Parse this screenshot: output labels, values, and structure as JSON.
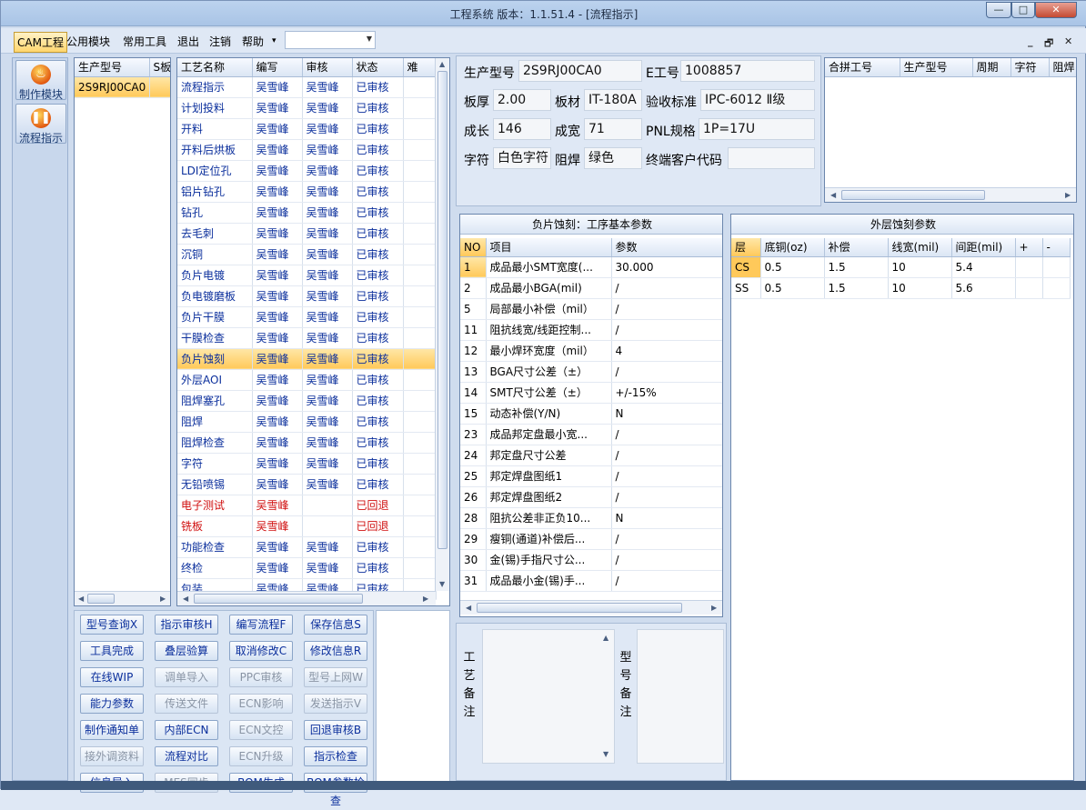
{
  "window": {
    "title": "工程系统   版本：1.1.51.4 - [流程指示]",
    "minimize": "—",
    "maximize": "□",
    "close": "✕"
  },
  "menu": {
    "items": [
      "CAM工程",
      "公用模块",
      "常用工具",
      "退出",
      "注销",
      "帮助"
    ],
    "help_arrow": "▾",
    "combo_value": "",
    "mdi_min": "_",
    "mdi_restore": "🗗",
    "mdi_close": "✕"
  },
  "sidebar": {
    "items": [
      {
        "label": "制作模块",
        "icon": "flame-icon"
      },
      {
        "label": "流程指示",
        "icon": "pause-icon"
      }
    ]
  },
  "models": {
    "headers": [
      "生产型号",
      "S板"
    ],
    "rows": [
      [
        "2S9RJ00CA0",
        ""
      ]
    ]
  },
  "process": {
    "headers": [
      "工艺名称",
      "编写",
      "审核",
      "状态",
      "难"
    ],
    "rows": [
      {
        "name": "流程指示",
        "writer": "吴雪峰",
        "reviewer": "吴雪峰",
        "status": "已审核",
        "color": "blue"
      },
      {
        "name": "计划投料",
        "writer": "吴雪峰",
        "reviewer": "吴雪峰",
        "status": "已审核",
        "color": "blue"
      },
      {
        "name": "开料",
        "writer": "吴雪峰",
        "reviewer": "吴雪峰",
        "status": "已审核",
        "color": "blue"
      },
      {
        "name": "开料后烘板",
        "writer": "吴雪峰",
        "reviewer": "吴雪峰",
        "status": "已审核",
        "color": "blue"
      },
      {
        "name": "LDI定位孔",
        "writer": "吴雪峰",
        "reviewer": "吴雪峰",
        "status": "已审核",
        "color": "blue"
      },
      {
        "name": "铝片钻孔",
        "writer": "吴雪峰",
        "reviewer": "吴雪峰",
        "status": "已审核",
        "color": "blue"
      },
      {
        "name": "钻孔",
        "writer": "吴雪峰",
        "reviewer": "吴雪峰",
        "status": "已审核",
        "color": "blue"
      },
      {
        "name": "去毛刺",
        "writer": "吴雪峰",
        "reviewer": "吴雪峰",
        "status": "已审核",
        "color": "blue"
      },
      {
        "name": "沉铜",
        "writer": "吴雪峰",
        "reviewer": "吴雪峰",
        "status": "已审核",
        "color": "blue"
      },
      {
        "name": "负片电镀",
        "writer": "吴雪峰",
        "reviewer": "吴雪峰",
        "status": "已审核",
        "color": "blue"
      },
      {
        "name": "负电镀磨板",
        "writer": "吴雪峰",
        "reviewer": "吴雪峰",
        "status": "已审核",
        "color": "blue"
      },
      {
        "name": "负片干膜",
        "writer": "吴雪峰",
        "reviewer": "吴雪峰",
        "status": "已审核",
        "color": "blue"
      },
      {
        "name": "干膜检查",
        "writer": "吴雪峰",
        "reviewer": "吴雪峰",
        "status": "已审核",
        "color": "blue"
      },
      {
        "name": "负片蚀刻",
        "writer": "吴雪峰",
        "reviewer": "吴雪峰",
        "status": "已审核",
        "color": "blue",
        "selected": true
      },
      {
        "name": "外层AOI",
        "writer": "吴雪峰",
        "reviewer": "吴雪峰",
        "status": "已审核",
        "color": "blue"
      },
      {
        "name": "阻焊塞孔",
        "writer": "吴雪峰",
        "reviewer": "吴雪峰",
        "status": "已审核",
        "color": "blue"
      },
      {
        "name": "阻焊",
        "writer": "吴雪峰",
        "reviewer": "吴雪峰",
        "status": "已审核",
        "color": "blue"
      },
      {
        "name": "阻焊检查",
        "writer": "吴雪峰",
        "reviewer": "吴雪峰",
        "status": "已审核",
        "color": "blue"
      },
      {
        "name": "字符",
        "writer": "吴雪峰",
        "reviewer": "吴雪峰",
        "status": "已审核",
        "color": "blue"
      },
      {
        "name": "无铅喷锡",
        "writer": "吴雪峰",
        "reviewer": "吴雪峰",
        "status": "已审核",
        "color": "blue"
      },
      {
        "name": "电子测试",
        "writer": "吴雪峰",
        "reviewer": "",
        "status": "已回退",
        "color": "red"
      },
      {
        "name": "铣板",
        "writer": "吴雪峰",
        "reviewer": "",
        "status": "已回退",
        "color": "red"
      },
      {
        "name": "功能检查",
        "writer": "吴雪峰",
        "reviewer": "吴雪峰",
        "status": "已审核",
        "color": "blue"
      },
      {
        "name": "终检",
        "writer": "吴雪峰",
        "reviewer": "吴雪峰",
        "status": "已审核",
        "color": "blue"
      },
      {
        "name": "包装",
        "writer": "吴雪峰",
        "reviewer": "吴雪峰",
        "status": "已审核",
        "color": "blue"
      }
    ]
  },
  "actions": [
    [
      "型号查询X",
      "指示审核H",
      "编写流程F",
      "保存信息S"
    ],
    [
      "工具完成",
      "叠层验算",
      "取消修改C",
      "修改信息R"
    ],
    [
      "在线WIP",
      "调单导入",
      "PPC审核",
      "型号上网W"
    ],
    [
      "能力参数",
      "传送文件",
      "ECN影响",
      "发送指示V"
    ],
    [
      "制作通知单",
      "内部ECN",
      "ECN文控",
      "回退审核B"
    ],
    [
      "接外调资料",
      "流程对比",
      "ECN升级",
      "指示检查"
    ],
    [
      "信息导入",
      "MES同步",
      "BOM生成",
      "BOM参数检查"
    ]
  ],
  "actions_disabled": [
    [
      false,
      false,
      false,
      false
    ],
    [
      false,
      false,
      false,
      false
    ],
    [
      false,
      true,
      true,
      true
    ],
    [
      false,
      true,
      true,
      true
    ],
    [
      false,
      false,
      true,
      false
    ],
    [
      true,
      false,
      true,
      false
    ],
    [
      false,
      true,
      false,
      false
    ]
  ],
  "info": {
    "model_label": "生产型号",
    "model": "2S9RJ00CA0",
    "eng_label": "E工号",
    "eng": "1008857",
    "thick_label": "板厚",
    "thick": "2.00",
    "mat_label": "板材",
    "mat": "IT-180A",
    "std_label": "验收标准",
    "std": "IPC-6012 Ⅱ级",
    "len_label": "成长",
    "len": "146",
    "wid_label": "成宽",
    "wid": "71",
    "pnl_label": "PNL规格",
    "pnl": "1P=17U",
    "char_label": "字符",
    "char": "白色字符",
    "mask_label": "阻焊",
    "mask": "绿色",
    "cust_label": "终端客户代码",
    "cust": ""
  },
  "merge": {
    "headers": [
      "合拼工号",
      "生产型号",
      "周期",
      "字符",
      "阻焊"
    ]
  },
  "params": {
    "title": "负片蚀刻：工序基本参数",
    "headers": [
      "NO",
      "项目",
      "参数"
    ],
    "rows": [
      [
        "1",
        "成品最小SMT宽度(...",
        "30.000"
      ],
      [
        "2",
        "成品最小BGA(mil)",
        "/"
      ],
      [
        "5",
        "局部最小补偿（mil）",
        "/"
      ],
      [
        "11",
        "阻抗线宽/线距控制...",
        "/"
      ],
      [
        "12",
        "最小焊环宽度（mil）",
        "4"
      ],
      [
        "13",
        "BGA尺寸公差（±）",
        "/"
      ],
      [
        "14",
        "SMT尺寸公差（±）",
        "+/-15%"
      ],
      [
        "15",
        "动态补偿(Y/N)",
        "N"
      ],
      [
        "23",
        "成品邦定盘最小宽...",
        "/"
      ],
      [
        "24",
        "邦定盘尺寸公差",
        "/"
      ],
      [
        "25",
        "邦定焊盘图纸1",
        "/"
      ],
      [
        "26",
        "邦定焊盘图纸2",
        "/"
      ],
      [
        "28",
        "阻抗公差非正负10...",
        "N"
      ],
      [
        "29",
        "瘦铜(通道)补偿后...",
        "/"
      ],
      [
        "30",
        "金(锡)手指尺寸公...",
        "/"
      ],
      [
        "31",
        "成品最小金(锡)手...",
        "/"
      ]
    ]
  },
  "outer": {
    "title": "外层蚀刻参数",
    "headers": [
      "层",
      "底铜(oz)",
      "补偿",
      "线宽(mil)",
      "间距(mil)",
      "+",
      "-"
    ],
    "rows": [
      [
        "CS",
        "0.5",
        "1.5",
        "10",
        "5.4",
        "",
        ""
      ],
      [
        "SS",
        "0.5",
        "1.5",
        "10",
        "5.6",
        "",
        ""
      ]
    ]
  },
  "notes": {
    "process_label": "工艺备注",
    "model_label": "型号备注"
  },
  "colors": {
    "selected": "#ffc95a",
    "ok_status": "#0b2f9c",
    "back_status": "#d01010"
  }
}
